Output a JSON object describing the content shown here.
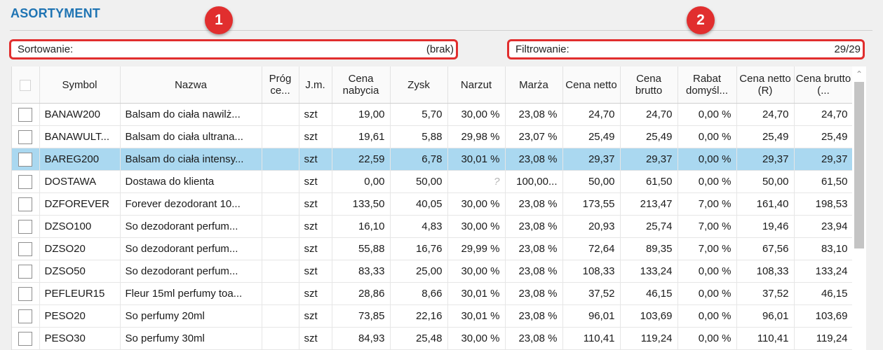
{
  "panel": {
    "title": "ASORTYMENT"
  },
  "markers": [
    "1",
    "2"
  ],
  "sort_bar": {
    "label": "Sortowanie:",
    "value": "(brak)"
  },
  "filter_bar": {
    "label": "Filtrowanie:",
    "value": "29/29"
  },
  "columns": [
    "",
    "Symbol",
    "Nazwa",
    "Próg ce...",
    "J.m.",
    "Cena nabycia",
    "Zysk",
    "Narzut",
    "Marża",
    "Cena netto",
    "Cena brutto",
    "Rabat domyśl...",
    "Cena netto (R)",
    "Cena brutto (..."
  ],
  "rows": [
    {
      "symbol": "BANAW200",
      "nazwa": "Balsam do ciała nawilż...",
      "prog": "",
      "jm": "szt",
      "cena_nabycia": "19,00",
      "zysk": "5,70",
      "narzut": "30,00 %",
      "marza": "23,08 %",
      "cena_netto": "24,70",
      "cena_brutto": "24,70",
      "rabat": "0,00 %",
      "cena_netto_r": "24,70",
      "cena_brutto_r": "24,70",
      "selected": false
    },
    {
      "symbol": "BANAWULT...",
      "nazwa": "Balsam do ciała ultrana...",
      "prog": "",
      "jm": "szt",
      "cena_nabycia": "19,61",
      "zysk": "5,88",
      "narzut": "29,98 %",
      "marza": "23,07 %",
      "cena_netto": "25,49",
      "cena_brutto": "25,49",
      "rabat": "0,00 %",
      "cena_netto_r": "25,49",
      "cena_brutto_r": "25,49",
      "selected": false
    },
    {
      "symbol": "BAREG200",
      "nazwa": "Balsam do ciała intensy...",
      "prog": "",
      "jm": "szt",
      "cena_nabycia": "22,59",
      "zysk": "6,78",
      "narzut": "30,01 %",
      "marza": "23,08 %",
      "cena_netto": "29,37",
      "cena_brutto": "29,37",
      "rabat": "0,00 %",
      "cena_netto_r": "29,37",
      "cena_brutto_r": "29,37",
      "selected": true
    },
    {
      "symbol": "DOSTAWA",
      "nazwa": "Dostawa do klienta",
      "prog": "",
      "jm": "szt",
      "cena_nabycia": "0,00",
      "zysk": "50,00",
      "narzut": "?",
      "marza": "100,00...",
      "cena_netto": "50,00",
      "cena_brutto": "61,50",
      "rabat": "0,00 %",
      "cena_netto_r": "50,00",
      "cena_brutto_r": "61,50",
      "selected": false
    },
    {
      "symbol": "DZFOREVER",
      "nazwa": "Forever dezodorant 10...",
      "prog": "",
      "jm": "szt",
      "cena_nabycia": "133,50",
      "zysk": "40,05",
      "narzut": "30,00 %",
      "marza": "23,08 %",
      "cena_netto": "173,55",
      "cena_brutto": "213,47",
      "rabat": "7,00 %",
      "cena_netto_r": "161,40",
      "cena_brutto_r": "198,53",
      "selected": false
    },
    {
      "symbol": "DZSO100",
      "nazwa": "So dezodorant perfum...",
      "prog": "",
      "jm": "szt",
      "cena_nabycia": "16,10",
      "zysk": "4,83",
      "narzut": "30,00 %",
      "marza": "23,08 %",
      "cena_netto": "20,93",
      "cena_brutto": "25,74",
      "rabat": "7,00 %",
      "cena_netto_r": "19,46",
      "cena_brutto_r": "23,94",
      "selected": false
    },
    {
      "symbol": "DZSO20",
      "nazwa": "So dezodorant perfum...",
      "prog": "",
      "jm": "szt",
      "cena_nabycia": "55,88",
      "zysk": "16,76",
      "narzut": "29,99 %",
      "marza": "23,08 %",
      "cena_netto": "72,64",
      "cena_brutto": "89,35",
      "rabat": "7,00 %",
      "cena_netto_r": "67,56",
      "cena_brutto_r": "83,10",
      "selected": false
    },
    {
      "symbol": "DZSO50",
      "nazwa": "So dezodorant perfum...",
      "prog": "",
      "jm": "szt",
      "cena_nabycia": "83,33",
      "zysk": "25,00",
      "narzut": "30,00 %",
      "marza": "23,08 %",
      "cena_netto": "108,33",
      "cena_brutto": "133,24",
      "rabat": "0,00 %",
      "cena_netto_r": "108,33",
      "cena_brutto_r": "133,24",
      "selected": false
    },
    {
      "symbol": "PEFLEUR15",
      "nazwa": "Fleur 15ml perfumy toa...",
      "prog": "",
      "jm": "szt",
      "cena_nabycia": "28,86",
      "zysk": "8,66",
      "narzut": "30,01 %",
      "marza": "23,08 %",
      "cena_netto": "37,52",
      "cena_brutto": "46,15",
      "rabat": "0,00 %",
      "cena_netto_r": "37,52",
      "cena_brutto_r": "46,15",
      "selected": false
    },
    {
      "symbol": "PESO20",
      "nazwa": "So perfumy 20ml",
      "prog": "",
      "jm": "szt",
      "cena_nabycia": "73,85",
      "zysk": "22,16",
      "narzut": "30,01 %",
      "marza": "23,08 %",
      "cena_netto": "96,01",
      "cena_brutto": "103,69",
      "rabat": "0,00 %",
      "cena_netto_r": "96,01",
      "cena_brutto_r": "103,69",
      "selected": false
    },
    {
      "symbol": "PESO30",
      "nazwa": "So perfumy 30ml",
      "prog": "",
      "jm": "szt",
      "cena_nabycia": "84,93",
      "zysk": "25,48",
      "narzut": "30,00 %",
      "marza": "23,08 %",
      "cena_netto": "110,41",
      "cena_brutto": "119,24",
      "rabat": "0,00 %",
      "cena_netto_r": "110,41",
      "cena_brutto_r": "119,24",
      "selected": false
    }
  ],
  "colors": {
    "title": "#1f74b3",
    "annotation_red": "#e12e2e",
    "selection": "#aad8f0"
  },
  "icons": {
    "scroll_up": "chevron-up-icon"
  }
}
